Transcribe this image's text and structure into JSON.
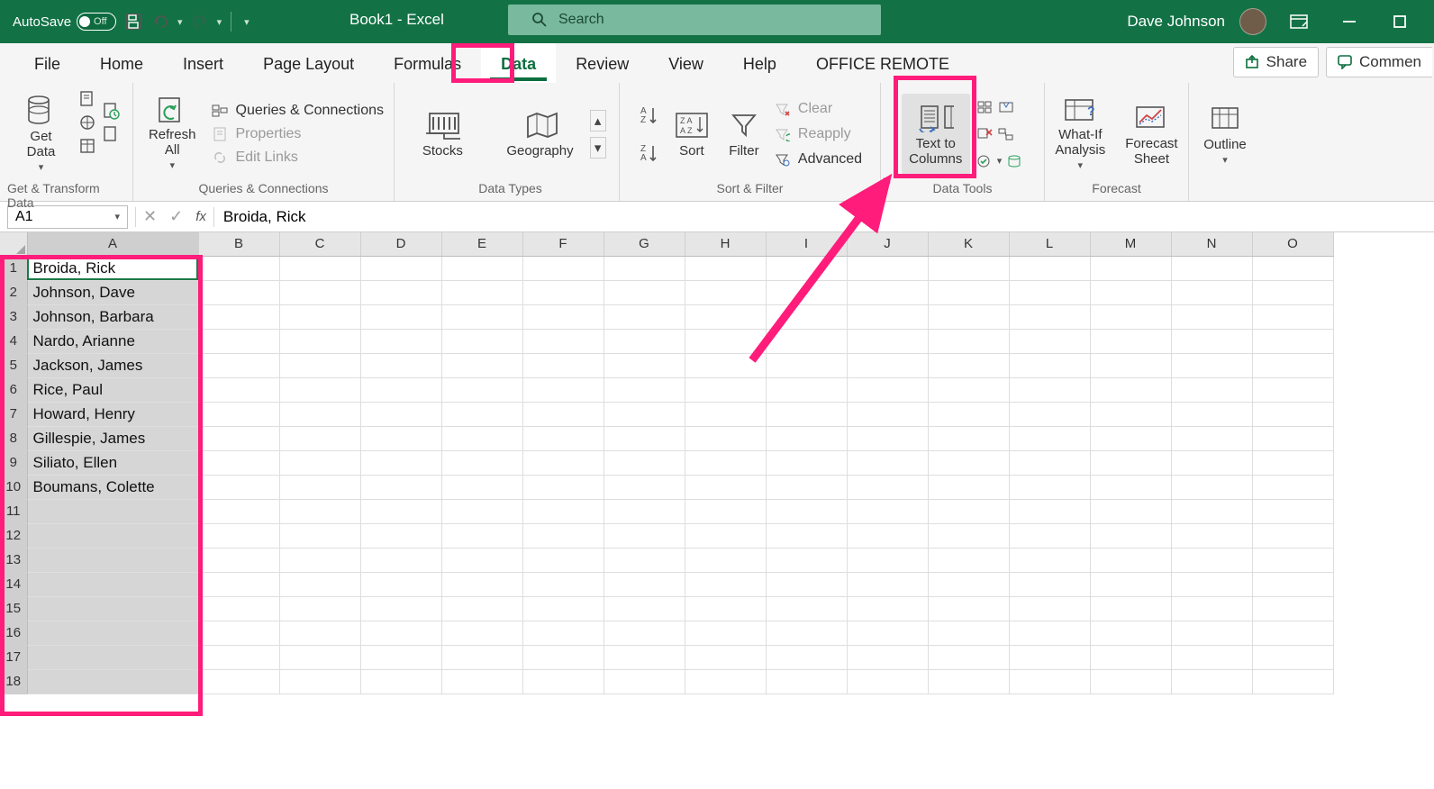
{
  "titlebar": {
    "autosave_label": "AutoSave",
    "autosave_off": "Off",
    "document_title": "Book1  -  Excel",
    "search_placeholder": "Search",
    "user_name": "Dave Johnson"
  },
  "tabs": {
    "file": "File",
    "home": "Home",
    "insert": "Insert",
    "page_layout": "Page Layout",
    "formulas": "Formulas",
    "data": "Data",
    "review": "Review",
    "view": "View",
    "help": "Help",
    "office_remote": "OFFICE REMOTE",
    "share": "Share",
    "comments": "Commen"
  },
  "ribbon": {
    "groups": {
      "get_transform": {
        "caption": "Get & Transform Data",
        "get_data": "Get\nData"
      },
      "queries": {
        "caption": "Queries & Connections",
        "refresh_all": "Refresh\nAll",
        "queries_connections": "Queries & Connections",
        "properties": "Properties",
        "edit_links": "Edit Links"
      },
      "data_types": {
        "caption": "Data Types",
        "stocks": "Stocks",
        "geography": "Geography"
      },
      "sort_filter": {
        "caption": "Sort & Filter",
        "sort": "Sort",
        "filter": "Filter",
        "clear": "Clear",
        "reapply": "Reapply",
        "advanced": "Advanced"
      },
      "data_tools": {
        "caption": "Data Tools",
        "text_to_columns": "Text to\nColumns"
      },
      "forecast": {
        "caption": "Forecast",
        "what_if": "What-If\nAnalysis",
        "forecast_sheet": "Forecast\nSheet"
      },
      "outline": {
        "caption": "",
        "outline": "Outline"
      }
    }
  },
  "formula_bar": {
    "name_box": "A1",
    "fx_label": "fx",
    "formula_text": "Broida, Rick"
  },
  "grid": {
    "columns": [
      "A",
      "B",
      "C",
      "D",
      "E",
      "F",
      "G",
      "H",
      "I",
      "J",
      "K",
      "L",
      "M",
      "N",
      "O"
    ],
    "row_count": 18,
    "selected_column": "A",
    "selected_rows": 18,
    "active_cell": "A1",
    "cells_colA": [
      "Broida, Rick",
      "Johnson, Dave",
      "Johnson, Barbara",
      "Nardo, Arianne",
      "Jackson, James",
      "Rice, Paul",
      "Howard, Henry",
      "Gillespie, James",
      "Siliato, Ellen",
      "Boumans, Colette",
      "",
      "",
      "",
      "",
      "",
      "",
      "",
      ""
    ]
  },
  "highlights": {
    "data_tab_box": true,
    "text_to_columns_box": true,
    "column_a_box": true,
    "arrow": true
  }
}
